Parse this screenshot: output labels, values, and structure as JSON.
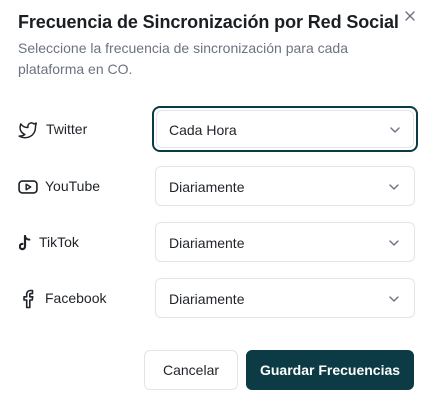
{
  "dialog": {
    "title": "Frecuencia de Sincronización por Red Social",
    "description": "Seleccione la frecuencia de sincronización para cada plataforma en CO.",
    "close_icon": "close-icon"
  },
  "platforms": [
    {
      "label": "Twitter",
      "icon": "twitter-icon",
      "frequency": "Cada Hora",
      "focused": true
    },
    {
      "label": "YouTube",
      "icon": "youtube-icon",
      "frequency": "Diariamente",
      "focused": false
    },
    {
      "label": "TikTok",
      "icon": "tiktok-icon",
      "frequency": "Diariamente",
      "focused": false
    },
    {
      "label": "Facebook",
      "icon": "facebook-icon",
      "frequency": "Diariamente",
      "focused": false
    }
  ],
  "footer": {
    "cancel_label": "Cancelar",
    "save_label": "Guardar Frecuencias"
  },
  "colors": {
    "primary": "#0d3b45",
    "border": "#e1e4e8",
    "muted_text": "#6b7280"
  }
}
